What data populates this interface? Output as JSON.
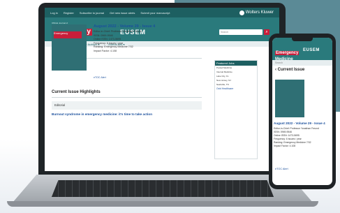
{
  "topbar": {
    "links": [
      "Log in",
      "Register",
      "Subscribe to journal",
      "Get new issue alerts",
      "Submit your manuscript"
    ],
    "publisher": "Wolters Kluwer"
  },
  "brand": {
    "small": "Official Journal of",
    "title_line1": "Emergency",
    "title_line2": "Medicine",
    "society": "EUSEM"
  },
  "search": {
    "placeholder": "Search"
  },
  "nav": {
    "items": [
      "Articles & Issues ▾",
      "For Authors ▾",
      "Journal Info ▾"
    ]
  },
  "current_issue": {
    "heading": "Current Issue",
    "title": "August 2022 - Volume 29 - Issue 4",
    "editor": "Editor-in-Chief: Professor Yonathan Freund",
    "issn": "ISSN: 0969-9546",
    "online_issn": "Online ISSN: 1473-5695",
    "frequency": "Frequency: 6 issues / year",
    "ranking": "Ranking: Emergency Medicine 7/32",
    "impact": "Impact Factor: 4.108",
    "etoc": "eTOC Alert"
  },
  "highlights": {
    "heading": "Current Issue Highlights",
    "category": "Editorial",
    "article": "Burnout syndrome in emergency medicine: it's time to take action"
  },
  "sidebar": {
    "heading": "Featured Jobs",
    "items": [
      "Pooled Medicine",
      "Internal Medicine",
      "Lake City, FL",
      "New Jersey, NJ",
      "Nashville, TN"
    ],
    "link": "Ovid Healthcare"
  },
  "phone": {
    "search_placeholder": "Search",
    "current": "‹ Current Issue",
    "issue_title": "August 2022 - Volume 29 - Issue 4",
    "meta": [
      "Editor-in-Chief: Professor Yonathan Freund",
      "ISSN: 0969-9546",
      "Online ISSN: 1473-5695",
      "Frequency: 6 issues / year",
      "Ranking: Emergency Medicine 7/32",
      "Impact Factor: 4.108"
    ],
    "etoc": "eTOC Alert"
  },
  "colors": {
    "teal_dark": "#1d5f61",
    "teal": "#2a7a7c",
    "red": "#c81e3a",
    "link_blue": "#1a4f9c"
  }
}
